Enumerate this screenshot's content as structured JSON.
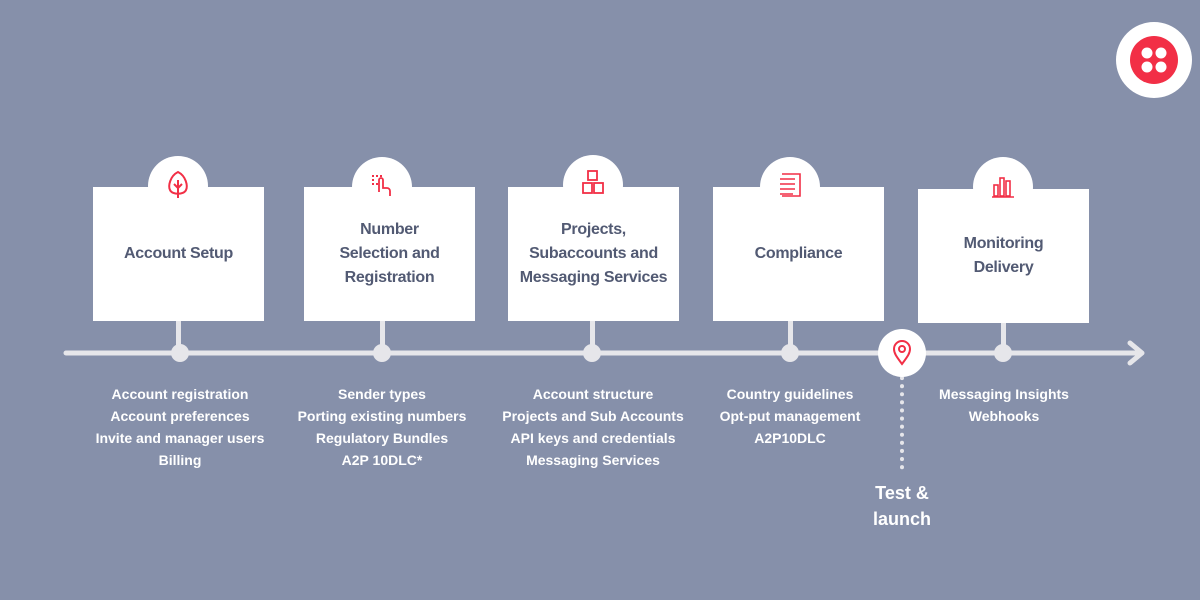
{
  "colors": {
    "background": "#8690aa",
    "accent": "#f22f46",
    "card": "#ffffff",
    "title_text": "#525a73",
    "timeline": "#e6e6ea"
  },
  "logo": {
    "icon": "twilio-logo-icon"
  },
  "stages": [
    {
      "title": "Account Setup",
      "icon": "tree-leaf-icon",
      "items": [
        "Account registration",
        "Account preferences",
        "Invite and manager users",
        "Billing"
      ]
    },
    {
      "title": "Number Selection and Registration",
      "icon": "touch-hand-icon",
      "items": [
        "Sender types",
        "Porting existing numbers",
        "Regulatory Bundles",
        "A2P 10DLC*"
      ]
    },
    {
      "title": "Projects, Subaccounts and Messaging Services",
      "icon": "blocks-icon",
      "items": [
        "Account structure",
        "Projects and Sub Accounts",
        "API keys and credentials",
        "Messaging Services"
      ]
    },
    {
      "title": "Compliance",
      "icon": "checklist-icon",
      "items": [
        "Country guidelines",
        "Opt-put management",
        "A2P10DLC"
      ]
    },
    {
      "title": "Monitoring Delivery",
      "icon": "bar-chart-icon",
      "items": [
        "Messaging Insights",
        "Webhooks"
      ]
    }
  ],
  "milestone": {
    "label_line1": "Test &",
    "label_line2": "launch",
    "icon": "location-pin-icon"
  }
}
